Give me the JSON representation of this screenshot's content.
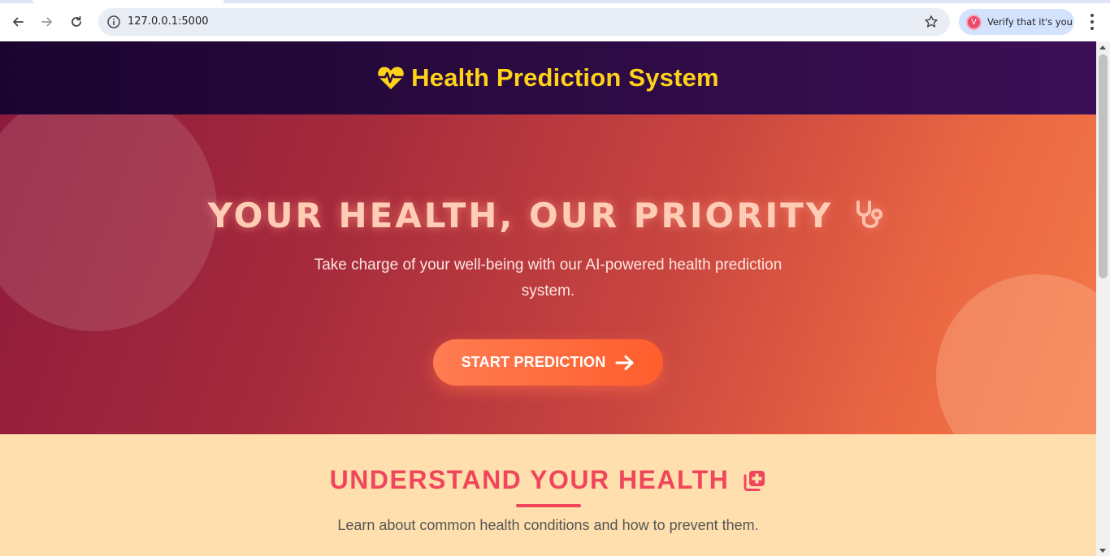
{
  "browser": {
    "url": "127.0.0.1:5000",
    "profile_label": "Verify that it's you",
    "profile_initial": "V",
    "icons": [
      "back-arrow-icon",
      "forward-arrow-icon",
      "reload-icon",
      "site-info-icon",
      "bookmark-star-icon",
      "more-menu-icon"
    ]
  },
  "header": {
    "title": "Health Prediction System",
    "icon": "heart-pulse-icon",
    "accent_color": "#ffd21a"
  },
  "hero": {
    "title": "YOUR HEALTH, OUR PRIORITY",
    "title_icon": "stethoscope-icon",
    "subtitle_line1": "Take charge of your well-being with our AI-powered health prediction",
    "subtitle_line2": "system.",
    "cta_label": "START PREDICTION",
    "cta_icon": "arrow-right-icon"
  },
  "understand": {
    "title": "UNDERSTAND YOUR HEALTH",
    "title_icon": "medical-copy-icon",
    "subtitle": "Learn about common health conditions and how to prevent them.",
    "accent_color": "#f0465b"
  }
}
